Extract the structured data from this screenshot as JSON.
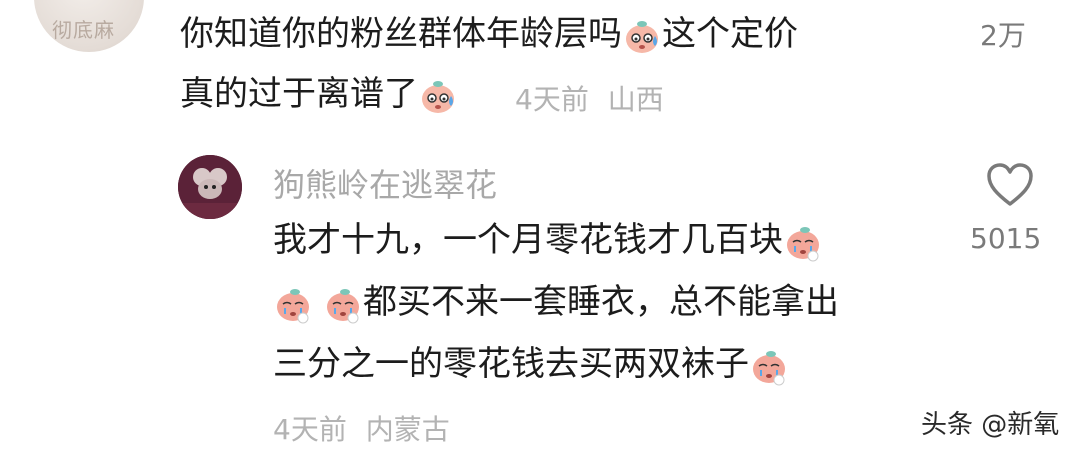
{
  "top_comment": {
    "avatar_text": "彻底麻",
    "line1": "你知道你的粉丝群体年龄层吗",
    "line1_after_emoji": "这个定价",
    "line2": "真的过于离谱了",
    "emoji_name": "sweat-face-emoji",
    "time": "4天前",
    "location": "山西",
    "likes": "2万"
  },
  "reply": {
    "username": "狗熊岭在逃翠花",
    "line1": "我才十九，一个月零花钱才几百块",
    "line2": "都买不来一套睡衣，总不能拿出",
    "line3": "三分之一的零花钱去买两双袜子",
    "emoji_name": "crying-face-emoji",
    "time": "4天前",
    "location": "内蒙古",
    "likes": "5015",
    "like_icon": "heart-icon"
  },
  "watermark": "头条 @新氧"
}
